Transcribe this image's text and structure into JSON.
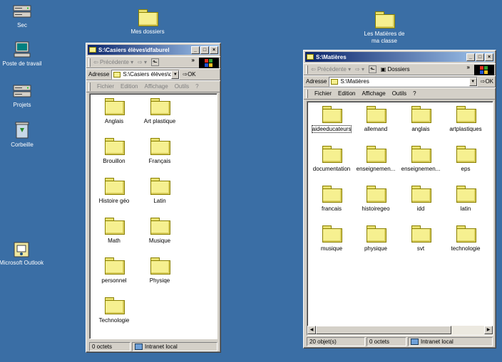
{
  "desktop": {
    "icons": [
      {
        "label": "Sec",
        "icon": "server-icon"
      },
      {
        "label": "Poste de travail",
        "icon": "computer-icon"
      },
      {
        "label": "Projets",
        "icon": "server-icon"
      },
      {
        "label": "Corbeille",
        "icon": "recycle-bin-icon"
      },
      {
        "label": "Microsoft Outlook",
        "icon": "outlook-icon"
      },
      {
        "label": "Mes dossiers",
        "icon": "folder-shortcut-icon"
      },
      {
        "label": "Les Matières de ma classe",
        "icon": "folder-shortcut-icon"
      }
    ]
  },
  "win1": {
    "title": "S:\\Casiers élèves\\dfaburel",
    "back_label": "Précédente",
    "address_label": "Adresse",
    "address_value": "S:\\Casiers élèves\\dfa",
    "ok_label": "OK",
    "chevron": "»",
    "menu": [
      "Fichier",
      "Edition",
      "Affichage",
      "Outils",
      "?"
    ],
    "folders": [
      "Anglais",
      "Art plastique",
      "Brouillon",
      "Français",
      "Histoire géo",
      "Latin",
      "Math",
      "Musique",
      "personnel",
      "Physiqe",
      "Technologie"
    ],
    "status": {
      "size": "0 octets",
      "zone": "Intranet local"
    }
  },
  "win2": {
    "title": "S:\\Matières",
    "back_label": "Précédente",
    "folders_button": "Dossiers",
    "address_label": "Adresse",
    "address_value": "S:\\Matières",
    "ok_label": "OK",
    "chevron": "»",
    "menu": [
      "Fichier",
      "Edition",
      "Affichage",
      "Outils",
      "?"
    ],
    "folders": [
      "aideeducateurs",
      "allemand",
      "anglais",
      "artplastiques",
      "documentation",
      "enseignemen...",
      "enseignemen...",
      "eps",
      "francais",
      "histoiregeo",
      "idd",
      "latin",
      "musique",
      "physique",
      "svt",
      "technologie"
    ],
    "status": {
      "count": "20 objet(s)",
      "size": "0 octets",
      "zone": "Intranet local"
    }
  }
}
